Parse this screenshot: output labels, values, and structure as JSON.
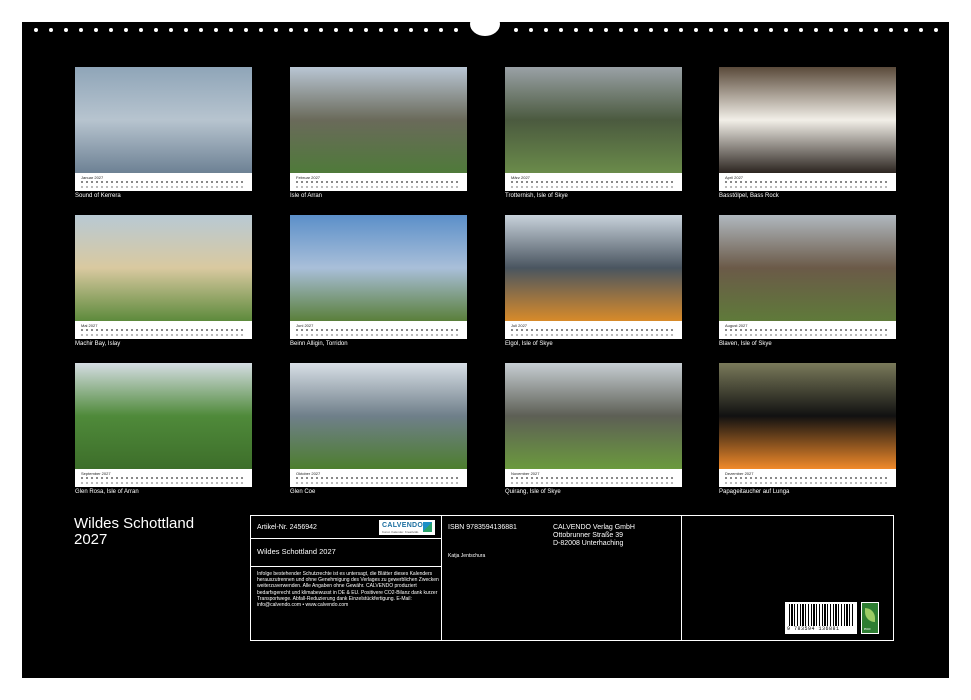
{
  "title_line1": "Wildes Schottland",
  "title_line2": "2027",
  "months": [
    {
      "label": "Januar 2027",
      "caption": "Sound of Kerrera",
      "colors": [
        "#8fa5b8",
        "#b7c4cf",
        "#6d8194"
      ]
    },
    {
      "label": "Februar 2027",
      "caption": "Isle of Arran",
      "colors": [
        "#b9c6d4",
        "#6a6a5a",
        "#4f7a3a"
      ]
    },
    {
      "label": "März 2027",
      "caption": "Trotternish, Isle of Skye",
      "colors": [
        "#9aa1a6",
        "#4b5a3f",
        "#6a8b4a"
      ]
    },
    {
      "label": "April 2027",
      "caption": "Basstölpel, Bass Rock",
      "colors": [
        "#5a4a3a",
        "#f2efe8",
        "#2c2520"
      ]
    },
    {
      "label": "Mai 2027",
      "caption": "Machir Bay, Islay",
      "colors": [
        "#b8c9d4",
        "#d9c9a0",
        "#5d8a3c"
      ]
    },
    {
      "label": "Juni 2027",
      "caption": "Beinn Alligin, Torridon",
      "colors": [
        "#5b8fc9",
        "#a9bfd9",
        "#5a7f3a"
      ]
    },
    {
      "label": "Juli 2027",
      "caption": "Elgol, Isle of Skye",
      "colors": [
        "#c8d2db",
        "#4a5560",
        "#d88a2a"
      ]
    },
    {
      "label": "August 2027",
      "caption": "Blaven, Isle of Skye",
      "colors": [
        "#b0b8bf",
        "#6b5a48",
        "#5f7a3a"
      ]
    },
    {
      "label": "September 2027",
      "caption": "Glen Rosa, Isle of Arran",
      "colors": [
        "#d5dde3",
        "#4f8a3a",
        "#3d6e2a"
      ]
    },
    {
      "label": "Oktober 2027",
      "caption": "Glen Coe",
      "colors": [
        "#d8dfe6",
        "#6f7f8a",
        "#4d7e2e"
      ]
    },
    {
      "label": "November 2027",
      "caption": "Quirang, Isle of Skye",
      "colors": [
        "#c7ced3",
        "#5d5f55",
        "#6b9a3e"
      ]
    },
    {
      "label": "Dezember 2027",
      "caption": "Papageitaucher auf Lunga",
      "colors": [
        "#7a7a5a",
        "#111111",
        "#f08a2a"
      ]
    }
  ],
  "info": {
    "artikel": "Artikel-Nr. 2456942",
    "calendar_name": "Wildes Schottland 2027",
    "legal": "Infolge bestehender Schutzrechte ist es untersagt, die Blätter dieses Kalenders herauszutrennen und ohne Genehmigung des Verlages zu gewerblichen Zwecken weiterzuverwenden. Alle Angaben ohne Gewähr. CALVENDO produziert bedarfsgerecht und klimabewusst in DE & EU. Positivere CO2-Bilanz dank kurzer Transportwege. Abfall-Reduzierung dank Einzelstückfertigung. E-Mail: info@calvendo.com • www.calvendo.com",
    "isbn": "ISBN 9783594136881",
    "author": "Katja Jentschura",
    "publisher": "CALVENDO Verlag GmbH",
    "street": "Ottobrunner Straße 39",
    "city": "D-82008 Unterhaching",
    "logo_text": "CALVENDO",
    "logo_sub": "Kunst. Kalender. Kreativität.",
    "barcode_number": "9 783594 136881",
    "eco_label": "eco"
  }
}
